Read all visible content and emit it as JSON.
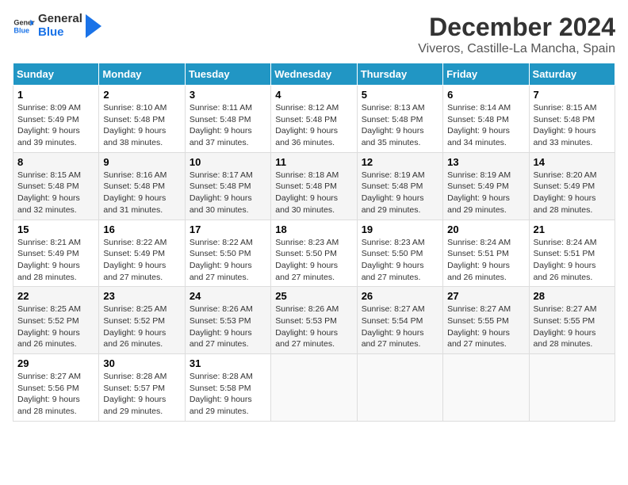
{
  "logo": {
    "line1": "General",
    "line2": "Blue"
  },
  "title": "December 2024",
  "subtitle": "Viveros, Castille-La Mancha, Spain",
  "weekdays": [
    "Sunday",
    "Monday",
    "Tuesday",
    "Wednesday",
    "Thursday",
    "Friday",
    "Saturday"
  ],
  "weeks": [
    [
      {
        "day": "1",
        "sunrise": "8:09 AM",
        "sunset": "5:49 PM",
        "daylight": "9 hours and 39 minutes."
      },
      {
        "day": "2",
        "sunrise": "8:10 AM",
        "sunset": "5:48 PM",
        "daylight": "9 hours and 38 minutes."
      },
      {
        "day": "3",
        "sunrise": "8:11 AM",
        "sunset": "5:48 PM",
        "daylight": "9 hours and 37 minutes."
      },
      {
        "day": "4",
        "sunrise": "8:12 AM",
        "sunset": "5:48 PM",
        "daylight": "9 hours and 36 minutes."
      },
      {
        "day": "5",
        "sunrise": "8:13 AM",
        "sunset": "5:48 PM",
        "daylight": "9 hours and 35 minutes."
      },
      {
        "day": "6",
        "sunrise": "8:14 AM",
        "sunset": "5:48 PM",
        "daylight": "9 hours and 34 minutes."
      },
      {
        "day": "7",
        "sunrise": "8:15 AM",
        "sunset": "5:48 PM",
        "daylight": "9 hours and 33 minutes."
      }
    ],
    [
      {
        "day": "8",
        "sunrise": "8:15 AM",
        "sunset": "5:48 PM",
        "daylight": "9 hours and 32 minutes."
      },
      {
        "day": "9",
        "sunrise": "8:16 AM",
        "sunset": "5:48 PM",
        "daylight": "9 hours and 31 minutes."
      },
      {
        "day": "10",
        "sunrise": "8:17 AM",
        "sunset": "5:48 PM",
        "daylight": "9 hours and 30 minutes."
      },
      {
        "day": "11",
        "sunrise": "8:18 AM",
        "sunset": "5:48 PM",
        "daylight": "9 hours and 30 minutes."
      },
      {
        "day": "12",
        "sunrise": "8:19 AM",
        "sunset": "5:48 PM",
        "daylight": "9 hours and 29 minutes."
      },
      {
        "day": "13",
        "sunrise": "8:19 AM",
        "sunset": "5:49 PM",
        "daylight": "9 hours and 29 minutes."
      },
      {
        "day": "14",
        "sunrise": "8:20 AM",
        "sunset": "5:49 PM",
        "daylight": "9 hours and 28 minutes."
      }
    ],
    [
      {
        "day": "15",
        "sunrise": "8:21 AM",
        "sunset": "5:49 PM",
        "daylight": "9 hours and 28 minutes."
      },
      {
        "day": "16",
        "sunrise": "8:22 AM",
        "sunset": "5:49 PM",
        "daylight": "9 hours and 27 minutes."
      },
      {
        "day": "17",
        "sunrise": "8:22 AM",
        "sunset": "5:50 PM",
        "daylight": "9 hours and 27 minutes."
      },
      {
        "day": "18",
        "sunrise": "8:23 AM",
        "sunset": "5:50 PM",
        "daylight": "9 hours and 27 minutes."
      },
      {
        "day": "19",
        "sunrise": "8:23 AM",
        "sunset": "5:50 PM",
        "daylight": "9 hours and 27 minutes."
      },
      {
        "day": "20",
        "sunrise": "8:24 AM",
        "sunset": "5:51 PM",
        "daylight": "9 hours and 26 minutes."
      },
      {
        "day": "21",
        "sunrise": "8:24 AM",
        "sunset": "5:51 PM",
        "daylight": "9 hours and 26 minutes."
      }
    ],
    [
      {
        "day": "22",
        "sunrise": "8:25 AM",
        "sunset": "5:52 PM",
        "daylight": "9 hours and 26 minutes."
      },
      {
        "day": "23",
        "sunrise": "8:25 AM",
        "sunset": "5:52 PM",
        "daylight": "9 hours and 26 minutes."
      },
      {
        "day": "24",
        "sunrise": "8:26 AM",
        "sunset": "5:53 PM",
        "daylight": "9 hours and 27 minutes."
      },
      {
        "day": "25",
        "sunrise": "8:26 AM",
        "sunset": "5:53 PM",
        "daylight": "9 hours and 27 minutes."
      },
      {
        "day": "26",
        "sunrise": "8:27 AM",
        "sunset": "5:54 PM",
        "daylight": "9 hours and 27 minutes."
      },
      {
        "day": "27",
        "sunrise": "8:27 AM",
        "sunset": "5:55 PM",
        "daylight": "9 hours and 27 minutes."
      },
      {
        "day": "28",
        "sunrise": "8:27 AM",
        "sunset": "5:55 PM",
        "daylight": "9 hours and 28 minutes."
      }
    ],
    [
      {
        "day": "29",
        "sunrise": "8:27 AM",
        "sunset": "5:56 PM",
        "daylight": "9 hours and 28 minutes."
      },
      {
        "day": "30",
        "sunrise": "8:28 AM",
        "sunset": "5:57 PM",
        "daylight": "9 hours and 29 minutes."
      },
      {
        "day": "31",
        "sunrise": "8:28 AM",
        "sunset": "5:58 PM",
        "daylight": "9 hours and 29 minutes."
      },
      null,
      null,
      null,
      null
    ]
  ],
  "labels": {
    "sunrise": "Sunrise:",
    "sunset": "Sunset:",
    "daylight": "Daylight:"
  }
}
